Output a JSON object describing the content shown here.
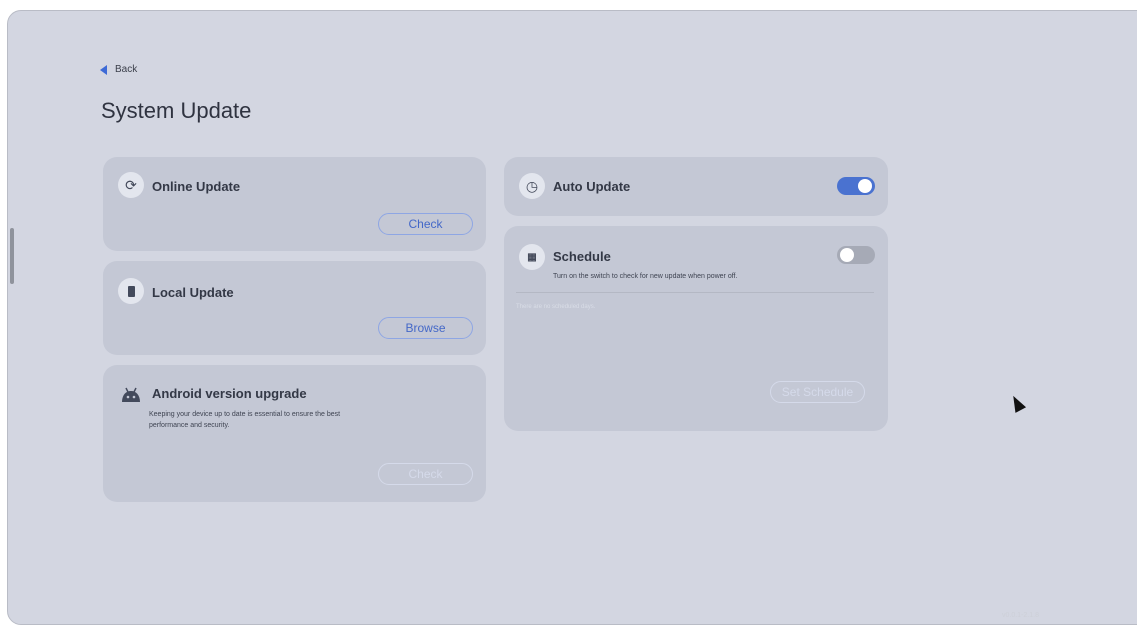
{
  "header": {
    "back_label": "Back",
    "page_title": "System Update"
  },
  "online_update": {
    "title": "Online Update",
    "button_label": "Check",
    "icon": "refresh-icon"
  },
  "local_update": {
    "title": "Local Update",
    "button_label": "Browse",
    "icon": "storage-icon"
  },
  "android_upgrade": {
    "title": "Android version upgrade",
    "description_line1": "Keeping your device up to date is essential to ensure the best",
    "description_line2": "performance and security.",
    "button_label": "Check",
    "icon": "android-icon"
  },
  "auto_update": {
    "title": "Auto Update",
    "enabled": true,
    "icon": "history-icon"
  },
  "schedule": {
    "title": "Schedule",
    "description": "Turn on the switch to check for new update when power off.",
    "empty_text": "There are no scheduled days.",
    "button_label": "Set Schedule",
    "enabled": false,
    "icon": "calendar-icon"
  },
  "footer": {
    "version": "v0.0.1-2.1.8"
  },
  "colors": {
    "accent": "#4a72d0",
    "card": "#c4c8d5",
    "background": "#d3d6e1"
  }
}
